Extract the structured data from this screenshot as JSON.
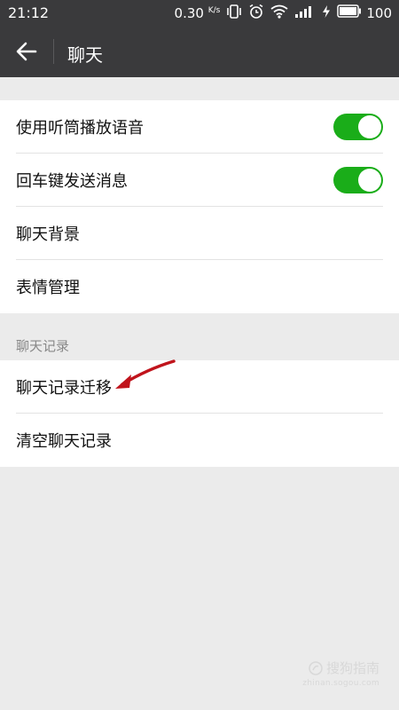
{
  "status_bar": {
    "time": "21:12",
    "net_speed": "0.30",
    "net_unit": "K/s",
    "battery": "100"
  },
  "header": {
    "title": "聊天"
  },
  "settings_group_1": {
    "items": [
      {
        "label": "使用听筒播放语音",
        "toggle": true
      },
      {
        "label": "回车键发送消息",
        "toggle": true
      },
      {
        "label": "聊天背景"
      },
      {
        "label": "表情管理"
      }
    ]
  },
  "chat_history_section": {
    "title": "聊天记录",
    "items": [
      {
        "label": "聊天记录迁移"
      },
      {
        "label": "清空聊天记录"
      }
    ]
  },
  "watermark": {
    "main": "搜狗指南",
    "sub": "zhinan.sogou.com"
  },
  "colors": {
    "header_bg": "#3a3a3c",
    "toggle_on": "#1aad19",
    "page_bg": "#ebebeb",
    "annotation": "#c0141c"
  }
}
